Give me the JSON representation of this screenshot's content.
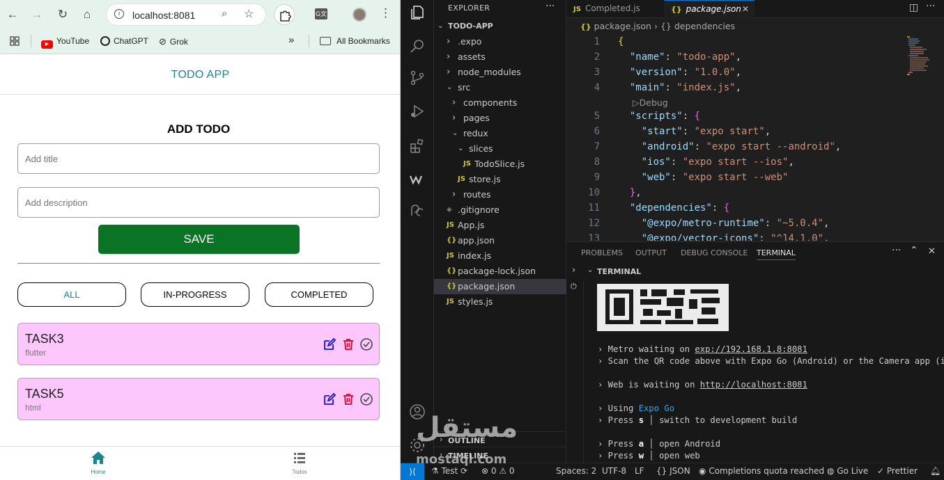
{
  "browser": {
    "url": "localhost:8081",
    "bookmarks": [
      "YouTube",
      "ChatGPT",
      "Grok"
    ],
    "all_bookmarks": "All Bookmarks"
  },
  "app": {
    "header": "TODO APP",
    "form_title": "ADD TODO",
    "title_placeholder": "Add title",
    "description_placeholder": "Add description",
    "save_label": "SAVE",
    "filters": [
      "ALL",
      "IN-PROGRESS",
      "COMPLETED"
    ],
    "tasks": [
      {
        "title": "TASK3",
        "desc": "flutter"
      },
      {
        "title": "TASK5",
        "desc": "html"
      }
    ],
    "tabs": [
      "Home",
      "Todos"
    ],
    "colors": {
      "accent": "#1a8493",
      "save": "#0b7424",
      "task_bg": "#fcc8fc"
    }
  },
  "vscode": {
    "explorer_title": "EXPLORER",
    "project": "TODO-APP",
    "tree": [
      {
        "name": ".expo",
        "type": "folder",
        "open": false,
        "depth": 0
      },
      {
        "name": "assets",
        "type": "folder",
        "open": false,
        "depth": 0
      },
      {
        "name": "node_modules",
        "type": "folder",
        "open": false,
        "depth": 0
      },
      {
        "name": "src",
        "type": "folder",
        "open": true,
        "depth": 0
      },
      {
        "name": "components",
        "type": "folder",
        "open": false,
        "depth": 1
      },
      {
        "name": "pages",
        "type": "folder",
        "open": false,
        "depth": 1
      },
      {
        "name": "redux",
        "type": "folder",
        "open": true,
        "depth": 1
      },
      {
        "name": "slices",
        "type": "folder",
        "open": true,
        "depth": 2
      },
      {
        "name": "TodoSlice.js",
        "type": "js",
        "depth": 3
      },
      {
        "name": "store.js",
        "type": "js",
        "depth": 2
      },
      {
        "name": "routes",
        "type": "folder",
        "open": false,
        "depth": 1
      },
      {
        "name": ".gitignore",
        "type": "git",
        "depth": 0
      },
      {
        "name": "App.js",
        "type": "js",
        "depth": 0
      },
      {
        "name": "app.json",
        "type": "json",
        "depth": 0
      },
      {
        "name": "index.js",
        "type": "js",
        "depth": 0
      },
      {
        "name": "package-lock.json",
        "type": "json",
        "depth": 0
      },
      {
        "name": "package.json",
        "type": "json",
        "depth": 0,
        "selected": true
      },
      {
        "name": "styles.js",
        "type": "js",
        "depth": 0
      }
    ],
    "tabs": [
      "Completed.js",
      "package.json"
    ],
    "breadcrumb": [
      "package.json",
      "{} dependencies"
    ],
    "debug_lens": "Debug",
    "line_numbers": [
      "1",
      "2",
      "3",
      "4",
      "5",
      "6",
      "7",
      "8",
      "9",
      "10",
      "11",
      "12",
      "13"
    ],
    "code": {
      "name_key": "\"name\"",
      "name_val": "\"todo-app\"",
      "version_key": "\"version\"",
      "version_val": "\"1.0.0\"",
      "main_key": "\"main\"",
      "main_val": "\"index.js\"",
      "scripts_key": "\"scripts\"",
      "start_key": "\"start\"",
      "start_val": "\"expo start\"",
      "android_key": "\"android\"",
      "android_val": "\"expo start --android\"",
      "ios_key": "\"ios\"",
      "ios_val": "\"expo start --ios\"",
      "web_key": "\"web\"",
      "web_val": "\"expo start --web\"",
      "deps_key": "\"dependencies\"",
      "metro_key": "\"@expo/metro-runtime\"",
      "metro_val": "\"~5.0.4\"",
      "vector_key": "\"@expo/vector-icons\"",
      "vector_val": "\"^14.1.0\""
    },
    "panel_tabs": [
      "PROBLEMS",
      "OUTPUT",
      "DEBUG CONSOLE",
      "TERMINAL"
    ],
    "terminal_title": "TERMINAL",
    "terminal": {
      "metro_prefix": "› Metro waiting on ",
      "metro_url": "exp://192.168.1.8:8081",
      "scan": "› Scan the QR code above with Expo Go (Android) or the Camera app (iOS)",
      "web_prefix": "› Web is waiting on ",
      "web_url": "http://localhost:8081",
      "using_prefix": "› Using ",
      "using_val": "Expo Go",
      "press": "› Press ",
      "s_key": "s",
      "s_desc": "switch to development build",
      "a_key": "a",
      "a_desc": "open Android",
      "w_key": "w",
      "w_desc": "open web"
    },
    "outline": "OUTLINE",
    "timeline": "TIMELINE",
    "status": {
      "test": "Test",
      "errors": "0",
      "warnings": "0",
      "spaces": "Spaces: 2",
      "encoding": "UTF-8",
      "eol": "LF",
      "lang": "JSON",
      "completions": "Completions quota reached",
      "golive": "Go Live",
      "prettier": "Prettier"
    }
  },
  "watermark": {
    "arabic": "مستقل",
    "latin": "mostaql.com"
  }
}
